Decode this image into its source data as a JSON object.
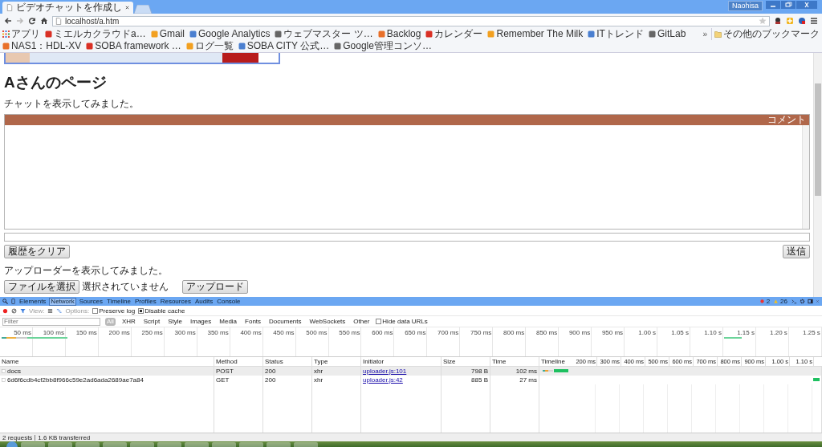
{
  "browser": {
    "tabs": [
      {
        "title": "ビデオチャットを作成し",
        "selected": true
      }
    ],
    "profile": "Naohisa",
    "address": "localhost/a.htm",
    "bookmarks": [
      {
        "label": "アプリ",
        "kind": "apps"
      },
      {
        "label": "ミエルカクラウドa…",
        "kind": "site"
      },
      {
        "label": "Gmail",
        "kind": "site"
      },
      {
        "label": "Google Analytics",
        "kind": "site"
      },
      {
        "label": "ウェブマスター ツ…",
        "kind": "site"
      },
      {
        "label": "Backlog",
        "kind": "site"
      },
      {
        "label": "カレンダー",
        "kind": "site"
      },
      {
        "label": "Remember The Milk",
        "kind": "site"
      },
      {
        "label": "ITトレンド",
        "kind": "site"
      },
      {
        "label": "GitLab",
        "kind": "site"
      },
      {
        "label": "NAS1：HDL-XV",
        "kind": "site"
      },
      {
        "label": "SOBA framework …",
        "kind": "site"
      },
      {
        "label": "ログ一覧",
        "kind": "site"
      },
      {
        "label": "SOBA CITY 公式…",
        "kind": "site"
      },
      {
        "label": "Google管理コンソ…",
        "kind": "site"
      }
    ],
    "more": "»",
    "other_bookmarks": "その他のブックマーク"
  },
  "page": {
    "heading": "Aさんのページ",
    "chat_intro": "チャットを表示してみました。",
    "chat_header": "コメント",
    "clear_button": "履歴をクリア",
    "send_button": "送信",
    "uploader_intro": "アップローダーを表示してみました。",
    "file_button": "ファイルを選択",
    "file_status": "選択されていません",
    "upload_button": "アップロード"
  },
  "devtools": {
    "tabs": [
      {
        "label": "Elements",
        "selected": false
      },
      {
        "label": "Network",
        "selected": true
      },
      {
        "label": "Sources",
        "selected": false
      },
      {
        "label": "Timeline",
        "selected": false
      },
      {
        "label": "Profiles",
        "selected": false
      },
      {
        "label": "Resources",
        "selected": false
      },
      {
        "label": "Audits",
        "selected": false
      },
      {
        "label": "Console",
        "selected": false
      }
    ],
    "errors": "2",
    "warnings": "26",
    "view_label": "View:",
    "options_label": "Options:",
    "options": [
      {
        "label": "Preserve log",
        "checked": false
      },
      {
        "label": "Disable cache",
        "checked": true
      }
    ],
    "filter_placeholder": "Filter",
    "type_filters": [
      {
        "label": "All",
        "selected": true
      },
      {
        "label": "XHR",
        "selected": false
      },
      {
        "label": "Script",
        "selected": false
      },
      {
        "label": "Style",
        "selected": false
      },
      {
        "label": "Images",
        "selected": false
      },
      {
        "label": "Media",
        "selected": false
      },
      {
        "label": "Fonts",
        "selected": false
      },
      {
        "label": "Documents",
        "selected": false
      },
      {
        "label": "WebSockets",
        "selected": false
      },
      {
        "label": "Other",
        "selected": false
      }
    ],
    "hide_data_urls": {
      "label": "Hide data URLs",
      "checked": false
    },
    "overview_ticks": [
      "50 ms",
      "100 ms",
      "150 ms",
      "200 ms",
      "250 ms",
      "300 ms",
      "350 ms",
      "400 ms",
      "450 ms",
      "500 ms",
      "550 ms",
      "600 ms",
      "650 ms",
      "700 ms",
      "750 ms",
      "800 ms",
      "850 ms",
      "900 ms",
      "950 ms",
      "1.00 s",
      "1.05 s",
      "1.10 s",
      "1.15 s",
      "1.20 s",
      "1.25 s"
    ],
    "columns": [
      "Name",
      "Method",
      "Status",
      "Type",
      "Initiator",
      "Size",
      "Time",
      "Timeline"
    ],
    "timeline_ticks": [
      "200 ms",
      "300 ms",
      "400 ms",
      "500 ms",
      "600 ms",
      "700 ms",
      "800 ms",
      "900 ms",
      "1.00 s",
      "1.10 s"
    ],
    "rows": [
      {
        "name": "docs",
        "method": "POST",
        "status": "200",
        "type": "xhr",
        "initiator": "uploader.js:101",
        "size": "798 B",
        "time": "102 ms",
        "selected": true
      },
      {
        "name": "6d6f6cdb4cf2bb8f966c59e2ad6ada2689ae7a84",
        "method": "GET",
        "status": "200",
        "type": "xhr",
        "initiator": "uploader.js:42",
        "size": "885 B",
        "time": "27 ms",
        "selected": false
      }
    ],
    "status_requests": "2 requests",
    "status_transferred": "1.6 KB transferred"
  }
}
